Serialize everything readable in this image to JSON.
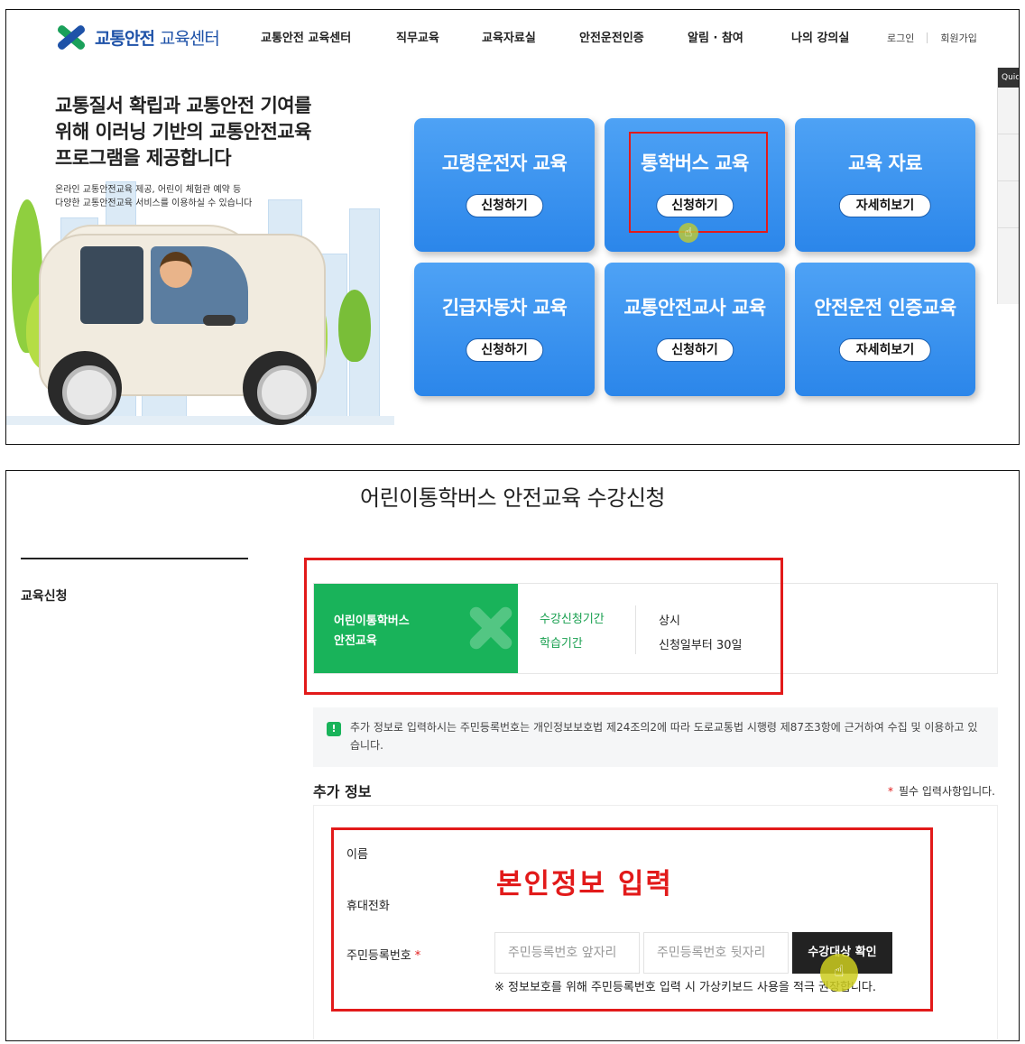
{
  "header": {
    "logo_bold": "교통안전",
    "logo_light": "교육센터",
    "nav": [
      "교통안전 교육센터",
      "직무교육",
      "교육자료실",
      "안전운전인증",
      "알림 · 참여",
      "나의 강의실"
    ],
    "login": "로그인",
    "signup": "회원가입",
    "quick_label": "Quick"
  },
  "hero": {
    "title_lines": [
      "교통질서 확립과 교통안전 기여를",
      "위해 이러닝 기반의 교통안전교육",
      "프로그램을 제공합니다"
    ],
    "sub_lines": [
      "온라인 교통안전교육 제공, 어린이 체험관 예약 등",
      "다양한 교통안전교육 서비스를 이용하실 수 있습니다"
    ]
  },
  "cards": [
    {
      "title": "고령운전자 교육",
      "button": "신청하기"
    },
    {
      "title": "통학버스 교육",
      "button": "신청하기"
    },
    {
      "title": "교육 자료",
      "button": "자세히보기"
    },
    {
      "title": "긴급자동차 교육",
      "button": "신청하기"
    },
    {
      "title": "교통안전교사 교육",
      "button": "신청하기"
    },
    {
      "title": "안전운전 인증교육",
      "button": "자세히보기"
    }
  ],
  "page2": {
    "title": "어린이통학버스 안전교육 수강신청",
    "sidebar_item": "교육신청",
    "course": {
      "name_lines": [
        "어린이통학버스",
        "안전교육"
      ],
      "labels": [
        "수강신청기간",
        "학습기간"
      ],
      "values": [
        "상시",
        "신청일부터 30일"
      ]
    },
    "notice": "추가 정보로 입력하시는 주민등록번호는 개인정보보호법 제24조의2에 따라 도로교통법 시행령 제87조3항에 근거하여 수집 및 이용하고 있습니다.",
    "section_title": "추가 정보",
    "required_note": "필수 입력사항입니다.",
    "form": {
      "name_label": "이름",
      "phone_label": "휴대전화",
      "rrn_label": "주민등록번호",
      "rrn_front_placeholder": "주민등록번호 앞자리",
      "rrn_back_placeholder": "주민등록번호 뒷자리",
      "verify_button": "수강대상 확인",
      "keyboard_note": "※ 정보보호를 위해 주민등록번호 입력 시 가상키보드 사용을 적극 권장합니다."
    },
    "annotation": "본인정보 입력"
  },
  "colors": {
    "brand_blue": "#1e52a8",
    "brand_green": "#19b35a",
    "card_blue": "#2b86ea",
    "highlight_red": "#e21a1a"
  },
  "icons": [
    "cursor-hand-icon",
    "notice-icon",
    "logo-mark-icon"
  ]
}
